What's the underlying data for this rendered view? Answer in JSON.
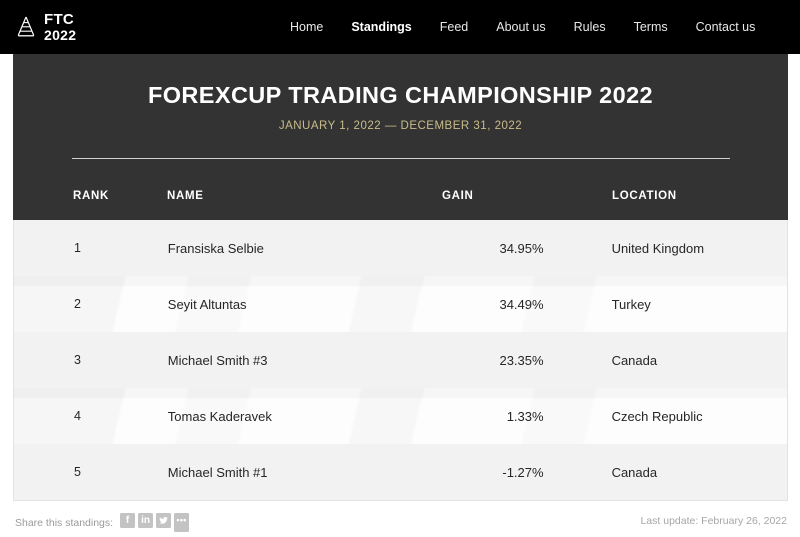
{
  "brand": {
    "icon": "pyramid-icon",
    "line1": "FTC",
    "line2": "2022"
  },
  "nav": {
    "items": [
      {
        "label": "Home",
        "active": false
      },
      {
        "label": "Standings",
        "active": true
      },
      {
        "label": "Feed",
        "active": false
      },
      {
        "label": "About us",
        "active": false
      },
      {
        "label": "Rules",
        "active": false
      },
      {
        "label": "Terms",
        "active": false
      },
      {
        "label": "Contact us",
        "active": false
      }
    ]
  },
  "hero": {
    "title": "FOREXCUP TRADING CHAMPIONSHIP 2022",
    "subtitle": "JANUARY 1, 2022 — DECEMBER 31, 2022",
    "subtitle_color": "#c9bc8a",
    "background_color": "#333333"
  },
  "table": {
    "headers": {
      "rank": "RANK",
      "name": "NAME",
      "gain": "GAIN",
      "location": "LOCATION"
    },
    "rows": [
      {
        "rank": "1",
        "name": "Fransiska Selbie",
        "gain": "34.95%",
        "location": "United Kingdom"
      },
      {
        "rank": "2",
        "name": "Seyit Altuntas",
        "gain": "34.49%",
        "location": "Turkey"
      },
      {
        "rank": "3",
        "name": "Michael Smith #3",
        "gain": "23.35%",
        "location": "Canada"
      },
      {
        "rank": "4",
        "name": "Tomas Kaderavek",
        "gain": "1.33%",
        "location": "Czech Republic"
      },
      {
        "rank": "5",
        "name": "Michael Smith #1",
        "gain": "-1.27%",
        "location": "Canada"
      }
    ]
  },
  "footer": {
    "share_label": "Share this standings:",
    "share_buttons": [
      {
        "name": "facebook-share-button",
        "glyph": "f"
      },
      {
        "name": "linkedin-share-button",
        "glyph": "in"
      },
      {
        "name": "twitter-share-button",
        "glyph": ""
      },
      {
        "name": "more-share-button",
        "glyph": "•••"
      }
    ],
    "last_update": "Last update: February 26, 2022"
  }
}
